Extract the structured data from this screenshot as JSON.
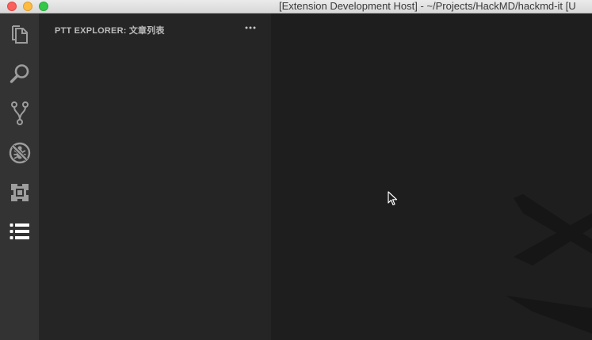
{
  "window": {
    "title": "[Extension Development Host] - ~/Projects/HackMD/hackmd-it [U"
  },
  "activity_bar": {
    "items": [
      {
        "icon": "files-icon"
      },
      {
        "icon": "search-icon"
      },
      {
        "icon": "source-control-icon"
      },
      {
        "icon": "debug-icon"
      },
      {
        "icon": "extensions-icon"
      },
      {
        "icon": "list-icon"
      }
    ]
  },
  "sidebar": {
    "title": "PTT EXPLORER: 文章列表",
    "more_icon": "more-icon"
  },
  "colors": {
    "activity_bar": "#333333",
    "sidebar": "#252526",
    "editor": "#1e1e1e",
    "icon_inactive": "#9d9d9d",
    "icon_active": "#ffffff"
  }
}
